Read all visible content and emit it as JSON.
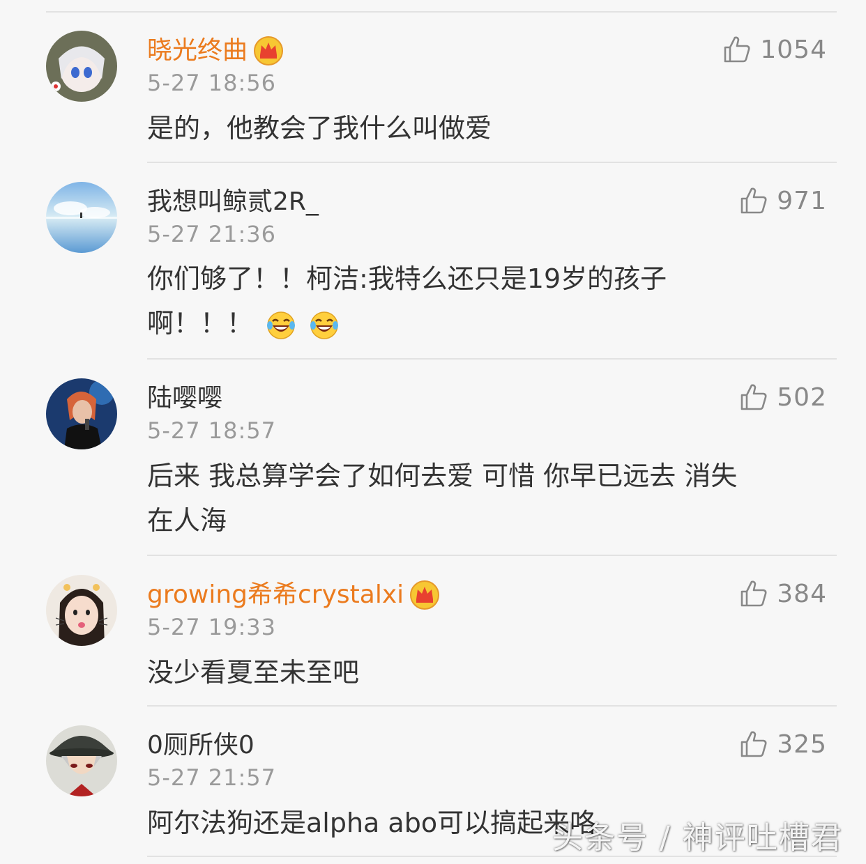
{
  "comments": [
    {
      "username": "晓光终曲",
      "vip": true,
      "time": "5-27 18:56",
      "likes": "1054",
      "lines": [
        "是的，他教会了我什么叫做爱"
      ],
      "emoji_count": 0
    },
    {
      "username": "我想叫鲸贰2R_",
      "vip": false,
      "time": "5-27 21:36",
      "likes": "971",
      "lines": [
        "你们够了！！柯洁:我特么还只是19岁的孩子",
        "啊！！！"
      ],
      "emoji_count": 2,
      "emoji": "laughing-tears-icon"
    },
    {
      "username": "陆嘤嘤",
      "vip": false,
      "time": "5-27 18:57",
      "likes": "502",
      "lines": [
        "后来 我总算学会了如何去爱 可惜 你早已远去 消失",
        "在人海"
      ],
      "emoji_count": 0
    },
    {
      "username": "growing希希crystalxi",
      "vip": true,
      "time": "5-27 19:33",
      "likes": "384",
      "lines": [
        "没少看夏至未至吧"
      ],
      "emoji_count": 0
    },
    {
      "username": "0厕所侠0",
      "vip": false,
      "time": "5-27 21:57",
      "likes": "325",
      "lines": [
        "阿尔法狗还是alpha abo可以搞起来咯"
      ],
      "emoji_count": 0
    }
  ],
  "watermark": "头条号 / 神评吐槽君",
  "colors": {
    "vip_name": "#eb7b1e",
    "name": "#333333",
    "time": "#9a9a9a",
    "likes": "#888888",
    "background": "#f7f7f7"
  }
}
